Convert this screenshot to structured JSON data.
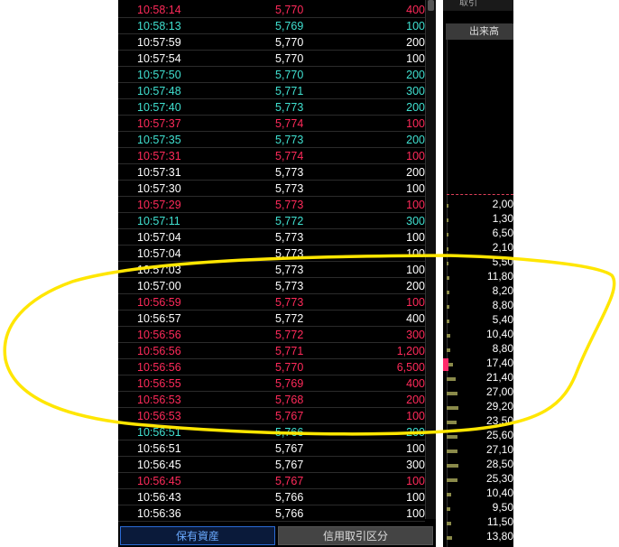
{
  "colors": {
    "up": "#ff2a5a",
    "down": "#40e0d0",
    "neutral": "#ffffff",
    "annotation": "#ffe600"
  },
  "ticks": [
    {
      "time": "10:58:14",
      "price": "5,770",
      "volume": "400",
      "dir": "up"
    },
    {
      "time": "10:58:13",
      "price": "5,769",
      "volume": "100",
      "dir": "down"
    },
    {
      "time": "10:57:59",
      "price": "5,770",
      "volume": "200",
      "dir": "neutral"
    },
    {
      "time": "10:57:54",
      "price": "5,770",
      "volume": "100",
      "dir": "neutral"
    },
    {
      "time": "10:57:50",
      "price": "5,770",
      "volume": "200",
      "dir": "down"
    },
    {
      "time": "10:57:48",
      "price": "5,771",
      "volume": "300",
      "dir": "down"
    },
    {
      "time": "10:57:40",
      "price": "5,773",
      "volume": "200",
      "dir": "down"
    },
    {
      "time": "10:57:37",
      "price": "5,774",
      "volume": "100",
      "dir": "up"
    },
    {
      "time": "10:57:35",
      "price": "5,773",
      "volume": "200",
      "dir": "down"
    },
    {
      "time": "10:57:31",
      "price": "5,774",
      "volume": "100",
      "dir": "up"
    },
    {
      "time": "10:57:31",
      "price": "5,773",
      "volume": "200",
      "dir": "neutral"
    },
    {
      "time": "10:57:30",
      "price": "5,773",
      "volume": "100",
      "dir": "neutral"
    },
    {
      "time": "10:57:29",
      "price": "5,773",
      "volume": "100",
      "dir": "up"
    },
    {
      "time": "10:57:11",
      "price": "5,772",
      "volume": "300",
      "dir": "down"
    },
    {
      "time": "10:57:04",
      "price": "5,773",
      "volume": "100",
      "dir": "neutral"
    },
    {
      "time": "10:57:04",
      "price": "5,773",
      "volume": "100",
      "dir": "neutral"
    },
    {
      "time": "10:57:03",
      "price": "5,773",
      "volume": "100",
      "dir": "neutral"
    },
    {
      "time": "10:57:00",
      "price": "5,773",
      "volume": "200",
      "dir": "neutral"
    },
    {
      "time": "10:56:59",
      "price": "5,773",
      "volume": "100",
      "dir": "up"
    },
    {
      "time": "10:56:57",
      "price": "5,772",
      "volume": "400",
      "dir": "neutral"
    },
    {
      "time": "10:56:56",
      "price": "5,772",
      "volume": "300",
      "dir": "up"
    },
    {
      "time": "10:56:56",
      "price": "5,771",
      "volume": "1,200",
      "dir": "up"
    },
    {
      "time": "10:56:56",
      "price": "5,770",
      "volume": "6,500",
      "dir": "up"
    },
    {
      "time": "10:56:55",
      "price": "5,769",
      "volume": "400",
      "dir": "up"
    },
    {
      "time": "10:56:53",
      "price": "5,768",
      "volume": "200",
      "dir": "up"
    },
    {
      "time": "10:56:53",
      "price": "5,767",
      "volume": "100",
      "dir": "up"
    },
    {
      "time": "10:56:51",
      "price": "5,766",
      "volume": "200",
      "dir": "down"
    },
    {
      "time": "10:56:51",
      "price": "5,767",
      "volume": "100",
      "dir": "neutral"
    },
    {
      "time": "10:56:45",
      "price": "5,767",
      "volume": "300",
      "dir": "neutral"
    },
    {
      "time": "10:56:45",
      "price": "5,767",
      "volume": "100",
      "dir": "up"
    },
    {
      "time": "10:56:43",
      "price": "5,766",
      "volume": "100",
      "dir": "neutral"
    },
    {
      "time": "10:56:36",
      "price": "5,766",
      "volume": "100",
      "dir": "neutral"
    }
  ],
  "tabs": {
    "holdings": "保有資産",
    "margin": "信用取引区分"
  },
  "right_panel": {
    "top_label": "取引",
    "header": "出来高",
    "volumes": [
      {
        "vol": "2,00",
        "bar": 2
      },
      {
        "vol": "1,30",
        "bar": 2
      },
      {
        "vol": "6,50",
        "bar": 2
      },
      {
        "vol": "2,10",
        "bar": 2
      },
      {
        "vol": "5,50",
        "bar": 2
      },
      {
        "vol": "11,80",
        "bar": 3
      },
      {
        "vol": "8,20",
        "bar": 3
      },
      {
        "vol": "8,80",
        "bar": 3
      },
      {
        "vol": "5,40",
        "bar": 3
      },
      {
        "vol": "10,40",
        "bar": 4
      },
      {
        "vol": "8,80",
        "bar": 4
      },
      {
        "vol": "17,40",
        "bar": 7
      },
      {
        "vol": "21,40",
        "bar": 10
      },
      {
        "vol": "27,00",
        "bar": 12
      },
      {
        "vol": "29,20",
        "bar": 13
      },
      {
        "vol": "23,50",
        "bar": 11
      },
      {
        "vol": "25,60",
        "bar": 12
      },
      {
        "vol": "27,10",
        "bar": 12
      },
      {
        "vol": "28,50",
        "bar": 13
      },
      {
        "vol": "25,30",
        "bar": 12
      },
      {
        "vol": "10,40",
        "bar": 5
      },
      {
        "vol": "9,50",
        "bar": 4
      },
      {
        "vol": "11,50",
        "bar": 5
      },
      {
        "vol": "13,80",
        "bar": 6
      }
    ]
  }
}
